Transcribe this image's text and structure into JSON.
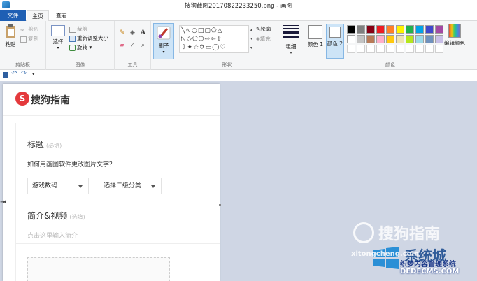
{
  "window": {
    "title": "搜狗截图20170822233250.png - 画图"
  },
  "tabs": {
    "file": "文件",
    "home": "主页",
    "view": "查看"
  },
  "ribbon": {
    "clipboard": {
      "paste": "粘贴",
      "cut": "剪切",
      "copy": "复制",
      "label": "剪贴板"
    },
    "image": {
      "select": "选择",
      "crop": "裁剪",
      "resize": "重新调整大小",
      "rotate": "旋转",
      "label": "图像"
    },
    "tools": {
      "label": "工具",
      "text_tool": "A"
    },
    "brushes": {
      "label": "刷子"
    },
    "shapes": {
      "outline": "轮廓",
      "fill": "填充",
      "label": "形状"
    },
    "size": {
      "label": "粗细"
    },
    "colors": {
      "color1": "颜色 1",
      "color2": "颜色 2",
      "edit": "编辑颜色",
      "label": "颜色",
      "palette_row1": [
        "#000000",
        "#7f7f7f",
        "#880015",
        "#ed1c24",
        "#ff7f27",
        "#fff200",
        "#22b14c",
        "#00a2e8",
        "#3f48cc",
        "#a349a4"
      ],
      "palette_row2": [
        "#ffffff",
        "#c3c3c3",
        "#b97a57",
        "#ffaec9",
        "#ffc90e",
        "#efe4b0",
        "#b5e61d",
        "#99d9ea",
        "#7092be",
        "#c8bfe7"
      ]
    }
  },
  "qat": {
    "customize": "▾"
  },
  "document": {
    "logo_mark": "S",
    "logo_text": "搜狗指南",
    "title_label": "标题",
    "title_hint": "(必填)",
    "question": "如何用画图软件更改图片文字？",
    "category1": "游戏数码",
    "category2": "选择二级分类",
    "intro_label": "简介&视频",
    "intro_hint": "(选填)",
    "intro_placeholder": "点击这里输入简介"
  },
  "watermarks": {
    "sogou": "搜狗指南",
    "site_cn": "系统城",
    "site_url": "xitongcheng.com",
    "site2_cn": "织梦内容管理系统",
    "site2_url": "DEDECMS.COM"
  }
}
